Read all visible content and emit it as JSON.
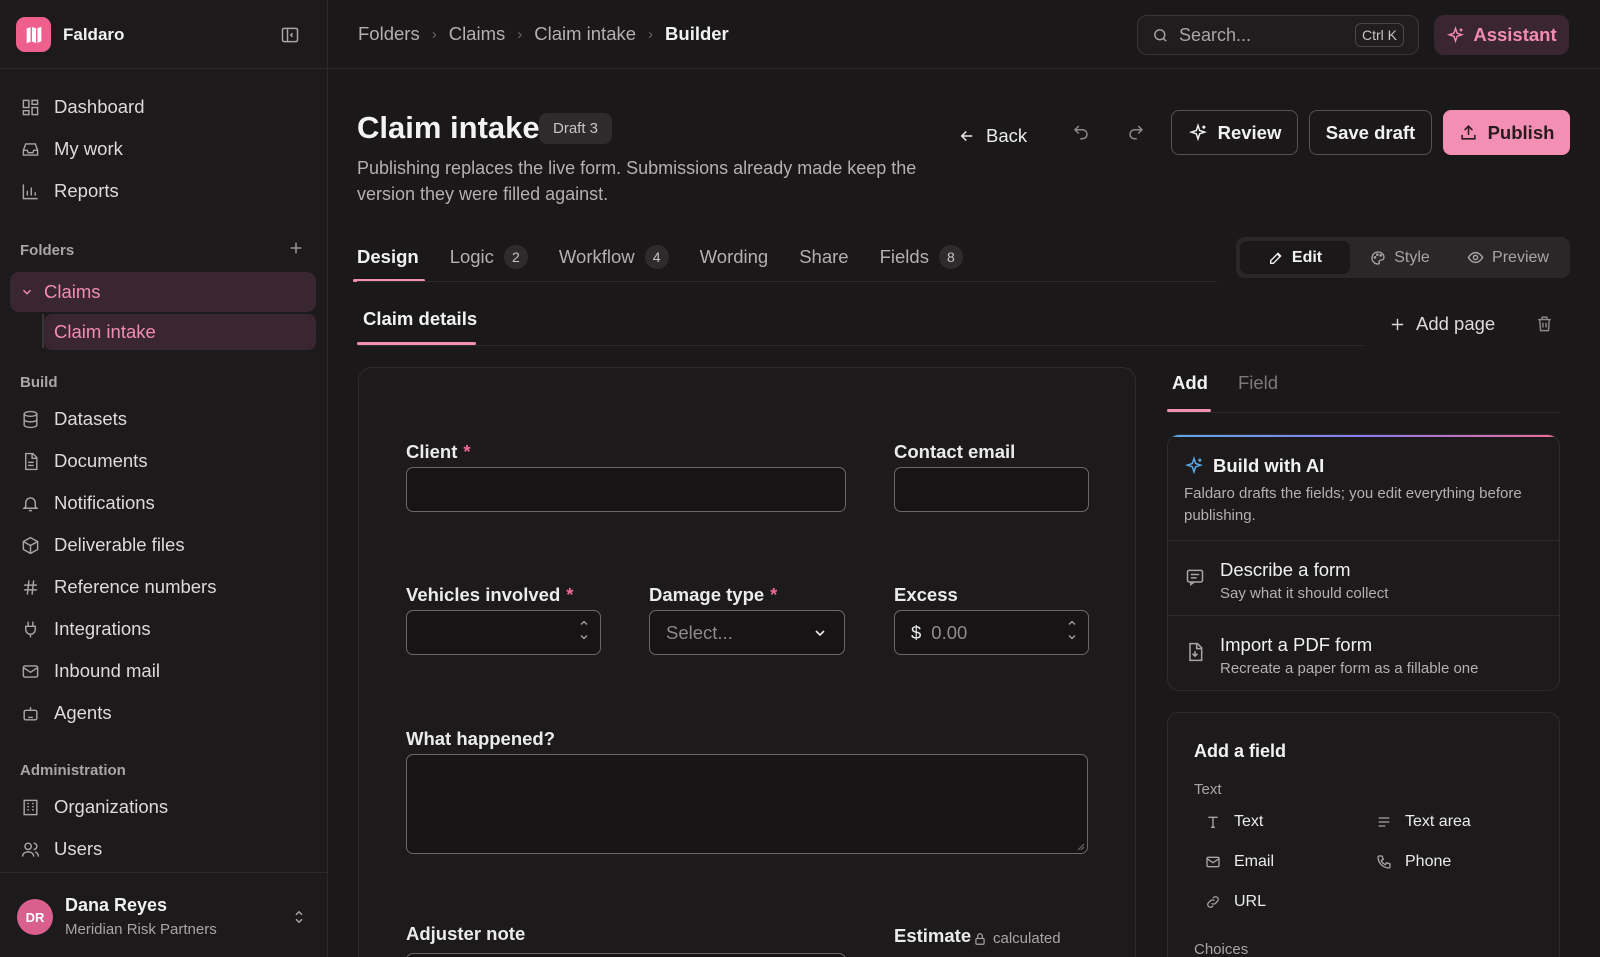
{
  "app": {
    "name": "Faldaro"
  },
  "sidebar": {
    "main_items": [
      {
        "label": "Dashboard",
        "icon": "dashboard-icon"
      },
      {
        "label": "My work",
        "icon": "inbox-icon"
      },
      {
        "label": "Reports",
        "icon": "bar-chart-icon"
      }
    ],
    "folders_label": "Folders",
    "folders": [
      {
        "label": "Claims",
        "children": [
          {
            "label": "Claim intake"
          }
        ]
      }
    ],
    "build_label": "Build",
    "build_items": [
      {
        "label": "Datasets",
        "icon": "database-icon"
      },
      {
        "label": "Documents",
        "icon": "document-icon"
      },
      {
        "label": "Notifications",
        "icon": "bell-icon"
      },
      {
        "label": "Deliverable files",
        "icon": "package-icon"
      },
      {
        "label": "Reference numbers",
        "icon": "hash-icon"
      },
      {
        "label": "Integrations",
        "icon": "plug-icon"
      },
      {
        "label": "Inbound mail",
        "icon": "mail-icon"
      },
      {
        "label": "Agents",
        "icon": "robot-icon"
      }
    ],
    "admin_label": "Administration",
    "admin_items": [
      {
        "label": "Organizations",
        "icon": "building-icon"
      },
      {
        "label": "Users",
        "icon": "users-icon"
      }
    ],
    "user": {
      "initials": "DR",
      "name": "Dana Reyes",
      "org": "Meridian Risk Partners"
    }
  },
  "topbar": {
    "breadcrumb": [
      "Folders",
      "Claims",
      "Claim intake",
      "Builder"
    ],
    "search": {
      "placeholder": "Search...",
      "shortcut": "Ctrl K"
    },
    "assistant_label": "Assistant"
  },
  "header": {
    "title": "Claim intake",
    "badge": "Draft 3",
    "description": "Publishing replaces the live form. Submissions already made keep the version they were filled against.",
    "back_label": "Back",
    "review_label": "Review",
    "save_label": "Save draft",
    "publish_label": "Publish"
  },
  "tabs": [
    {
      "label": "Design",
      "count": null,
      "active": true
    },
    {
      "label": "Logic",
      "count": "2"
    },
    {
      "label": "Workflow",
      "count": "4"
    },
    {
      "label": "Wording",
      "count": null
    },
    {
      "label": "Share",
      "count": null
    },
    {
      "label": "Fields",
      "count": "8"
    }
  ],
  "modes": {
    "edit": "Edit",
    "style": "Style",
    "preview": "Preview",
    "active": "edit"
  },
  "page_tabs": {
    "current": "Claim details",
    "add_label": "Add page"
  },
  "form": {
    "client": {
      "label": "Client",
      "required": "*",
      "value": ""
    },
    "contact_email": {
      "label": "Contact email",
      "value": ""
    },
    "vehicles": {
      "label": "Vehicles involved",
      "required": "*",
      "value": ""
    },
    "damage_type": {
      "label": "Damage type",
      "required": "*",
      "placeholder": "Select..."
    },
    "excess": {
      "label": "Excess",
      "currency": "$",
      "placeholder": "0.00"
    },
    "what_happened": {
      "label": "What happened?",
      "value": ""
    },
    "adjuster_note": {
      "label": "Adjuster note"
    },
    "estimate": {
      "label": "Estimate",
      "tag": "calculated"
    }
  },
  "right_panel": {
    "tabs": {
      "add": "Add",
      "field": "Field"
    },
    "ai": {
      "title": "Build with AI",
      "description": "Faldaro drafts the fields; you edit everything before publishing.",
      "options": [
        {
          "title": "Describe a form",
          "subtitle": "Say what it should collect",
          "icon": "message-icon"
        },
        {
          "title": "Import a PDF form",
          "subtitle": "Recreate a paper form as a fillable one",
          "icon": "file-import-icon"
        }
      ]
    },
    "add_field": {
      "title": "Add a field",
      "text_group": "Text",
      "text_items": [
        {
          "label": "Text",
          "icon": "text-icon"
        },
        {
          "label": "Text area",
          "icon": "text-area-icon"
        },
        {
          "label": "Email",
          "icon": "mail-icon"
        },
        {
          "label": "Phone",
          "icon": "phone-icon"
        },
        {
          "label": "URL",
          "icon": "link-icon"
        }
      ],
      "choices_group": "Choices"
    }
  },
  "colors": {
    "accent": "#f38fb2",
    "accent_bg": "#3a2630",
    "background": "#1a1819",
    "required": "#f06b93"
  }
}
